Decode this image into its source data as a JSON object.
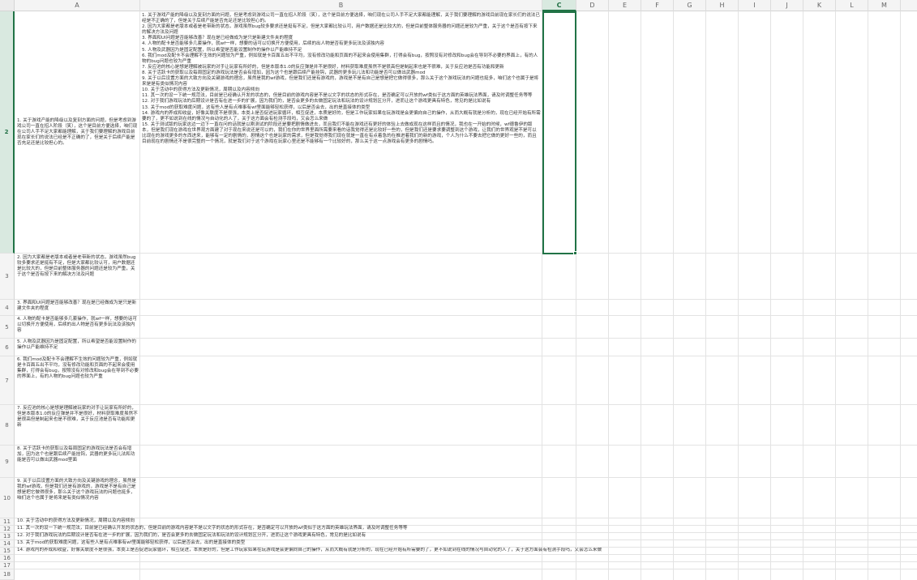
{
  "columns": [
    "A",
    "B",
    "C",
    "D",
    "E",
    "F",
    "G",
    "H",
    "I",
    "J",
    "K",
    "L",
    "M"
  ],
  "rows": [
    "1",
    "2",
    "3",
    "4",
    "5",
    "6",
    "7",
    "8",
    "9",
    "10",
    "11",
    "12",
    "13",
    "14",
    "15",
    "16",
    "17",
    "18"
  ],
  "selected_column": "C",
  "selected_row": "2",
  "cells": {
    "a2": "1. 关于游戏产能的降级以及复刻方面的问题，但是考虑到游戏公司一直在招人阶段（笑），这个是目前方便选择，咱们现在公司人手不足大家都能理解，关于我们要理解的游戏目前现在家长们的说法已经是不正确的了，但是关于后续产能是否充足还是比较担心的。",
    "b2": "1. 关于游戏产能的降级以及复刻方面的问题，但是考虑到游戏公司一直在招人阶段（笑），这个是目前方便选择，咱们现在公司人手不足大家都能理解，关于我们要理解的游戏目前现在家长们的说法已经是不正确的了，但是关于后续产能是否充足还是比较担心的。\n2. 因为大家都是老版本或者是老带新的状态，游戏虽然bug较多要求还是挺有不足，但是大家都比较认可，用户数据还是比较大的，但是目前整体服务器的问题还是较为严重，关于这个是否有按下来的解决方法及问题\n3. 界面和UI问题是否能够改善？现在是已经做成为是只是新建文件夹的程度\n4. 人物的配卡是否能够多几套操作，就wf一样，想要的话可以切换开方便使用，后续的出人物是否有更多玩法及该独内容\n5. 人物及武器因为是固定配置，所以希望是否能设置制作的操作以产能维持不足\n6. 我们mod及配卡不会理解不生效的问题较为严重，例如就是卡百面五出不平均，没有修改功能和页面的不起来会使用集群，打得会有bug，按照没有对修改和bug会在导到不必要的界面上，有的人物的bug问题也较为严重\n7. 反应池的核心是想是理解被玩家的对手让玩家有所好的，但是本版本1.0的反应弹是并不是很好，材料获取难度虽然不是很高但是制起来也是不很难，关于反应池是否有功能和更新\n8. 关于活跃卡的获取以及每周固定的游戏玩法是否会有增加，因为这个也是跟后续产能挂钩，武器的更多玩儿法和功能是否可以做出武器mod\n9. 关于以后设置方面的大致方向及关键游戏的理念，虽然是我的wf游戏，但是我们还是有游戏的，游戏是不是有自己是想是把它做得很多，那么关于这个游戏玩法的问题也挺多，咱们这个也属于是将来是是有类似情况内容\n10. 关于活动中的获得方法及更新情况，周期以及内容倾向\n11. 其一次的设一下统一规范法，目前是已经确认开发的状态的，但是目前的游戏内容是不是以文字的状态的形式存在，是否确定可以开放的wf类似于这方面的英雄玩法界面，请及时调整任务等等\n12. 对于我们游戏玩法的后期设计是否有在进一步的扩展，因为我们的，是否会更多的去做固定玩法和玩法的设计规划区分开，进而让这个游戏更具有特色，常见的是比如说有\n13. 关于mod的获取难度问题，这有些人是有点难事有wf里面能够轻松获得，以后是否会去，出的是直接体的类型\n14. 游戏内的养成和收益，好像关联度不是很强，本类上是否促进玩家循环，相互促进，本质是好的，但是工作玩家如果在玩游戏是会更偏向自己的操作，从而大概有就是分析的，现在已经开始有所需要的了，更不如说到在线的情况与自动化的人了，关于这方面会有检测手段吗，又会怎么来做\n15. 关于测试版的玩家这边一边下一直在问的话就是以刚测试的阶段还是要把剧情做进去，而且我们不能在游戏还有更好的体验上去做成现在这样而且的情况，我也在一开始的时候，wf德鲁伊的版本，但是我们现在游戏在世界观方面建了对于现在来说还是可以的，我们在你的世界里面所需要来看的话我觉得还是比较好一些的，但是我们还是要求要调整到这个游戏，让我们的世界观是不是可以比现在的游戏更多的东西进来，能够有一定的剧情的，剧情这个也是玩家的需求，但是我觉得我们现在就是一直在有点着急的在推进着我们的新的游戏，个人为什么不要去把它做的更好一些的，而且目前现在的剧情还不是很完整的一个情况，就是我们对于这个游戏在玩家心里还是不能够有一个比较好的，那么关于这一点游戏会有更多的剧情吗。",
    "a3": "2. 因为大家都是老版本或者是老带新的状态，游戏虽然bug较多要求还是挺有不足，但是大家都比较认可，用户数据还是比较大的，但是目前整体服务器的问题还是较为严重，关于这个是否有按下来的解决方法及问题",
    "a4": "3. 界面和UI问题是否能够改善？现在是已经做成为是只是新建文件夹的程度",
    "a5": "4. 人物的配卡是否能够多几套操作，就wf一样，想要的话可以切换开方便使用，后续的出人物是否有更多玩法及该独内容",
    "a6": "5. 人物及武器因为是固定配置，所以希望是否能设置制作的操作以产能维持不足",
    "a7": "6. 我们mod及配卡不会理解不生效的问题较为严重，例如就是卡百面五出不平均，没有修改功能和页面的不起来会使用集群，打得会有bug，按照没有对修改和bug会在导到不必要的界面上，有的人物的bug问题也较为严重",
    "a8": "7. 反应池的核心是想是理解被玩家的对手让玩家有所好的，但是本版本1.0的反应弹是并不是很好，材料获取难度虽然不是很高但是制起来也是不很难，关于反应池是否有功能和更新",
    "a9": "8. 关于活跃卡的获取以及每周固定的游戏玩法是否会有增加，因为这个也是跟后续产能挂钩，武器的更多玩儿法和功能是否可以做出武器mod里面",
    "a10": "9. 关于以后设置方面的大致方向及关键游戏的理念，虽然是我的wf游戏，但是我们还是有游戏的，游戏是不是有自己是想是把它做得很多，那么关于这个游戏玩法的问题也挺多，咱们这个也属于是将来是有类似情况内容",
    "a11": "10. 关于活动中的获得方法及更新情况，周期以及内容倾向",
    "a12": "11. 其一次的设一下统一规范法，目前是已经确认开发的状态的，但是目前的游戏内容是不是以文字的状态的形式存在，是否确定可以开放的wf类似于这方面的英雄玩法界面，请及时调整任务等等",
    "a13": "12. 对于我们游戏玩法的后期设计是否有在进一步的扩展，因为我们的，是否会更多的去做固定玩法和玩法的设计规划区分开，进而让这个游戏更具有特色，常见的是比如说有",
    "a14": "13. 关于mod的获取难度问题，这有些人是有点难事有wf里面能够轻松获得，以后是否会去，出的是直接体的类型",
    "a15": "14. 游戏内的养成和收益，好像关联度不是很强，本类上是否促进玩家循环，相互促进，本质是好的，但是工作玩家如果在玩游戏是会更偏向自己的操作，从而大概有就是分析的，现在已经开始有所需要的了，更不如说到在线的情况与自动化的人了，关于这方面会有检测手段吗，又会怎么来做"
  }
}
